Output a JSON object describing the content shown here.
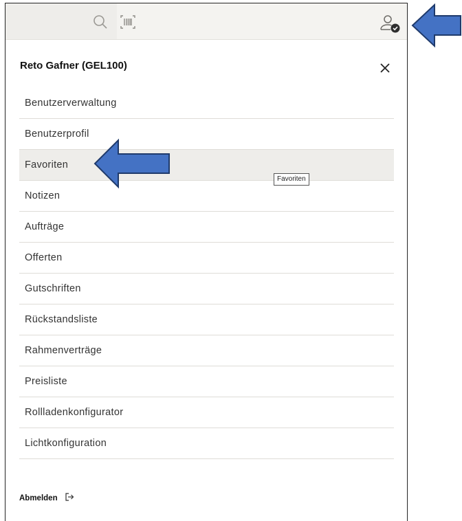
{
  "topbar": {
    "search_icon": "search-icon",
    "barcode_icon": "barcode-scan-icon",
    "user_icon": "user-check-icon"
  },
  "drawer": {
    "title": "Reto Gafner (GEL100)",
    "close_icon": "close-icon"
  },
  "menu": {
    "items": [
      {
        "label": "Benutzerverwaltung"
      },
      {
        "label": "Benutzerprofil"
      },
      {
        "label": "Favoriten"
      },
      {
        "label": "Notizen"
      },
      {
        "label": "Aufträge"
      },
      {
        "label": "Offerten"
      },
      {
        "label": "Gutschriften"
      },
      {
        "label": "Rückstandsliste"
      },
      {
        "label": "Rahmenverträge"
      },
      {
        "label": "Preisliste"
      },
      {
        "label": "Rollladenkonfigurator"
      },
      {
        "label": "Lichtkonfiguration"
      }
    ],
    "active_item": "Favoriten"
  },
  "tooltip": {
    "text": "Favoriten"
  },
  "logout": {
    "label": "Abmelden",
    "icon": "logout-icon"
  },
  "annotations": {
    "arrow_color": "#4472c4"
  }
}
